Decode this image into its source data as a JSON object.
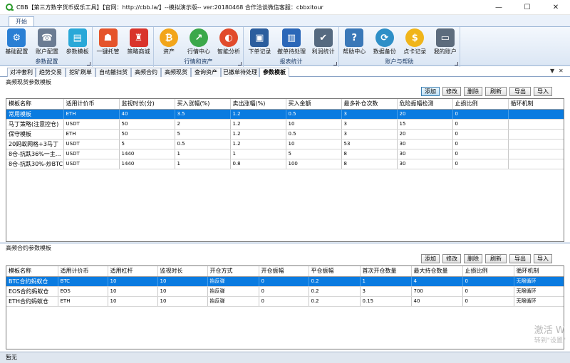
{
  "window": {
    "title": "CBB【第三方数字货币娱乐工具】【官网：http://cbb.la/】--模拟演示版-- ver:20180468    合作洽谈微信客服：cbbxitour",
    "min": "—",
    "max": "☐",
    "close": "✕"
  },
  "ribbon": {
    "tab": "开始",
    "groups": [
      {
        "label": "参数配置",
        "buttons": [
          {
            "label": "基础配置",
            "icon": "gear-box-icon",
            "color": "#2a7fd4",
            "glyph": "⚙"
          },
          {
            "label": "账户配置",
            "icon": "phone-icon",
            "color": "#6b7c93",
            "glyph": "☎"
          },
          {
            "label": "参数模板",
            "icon": "tablet-icon",
            "color": "#29a8d8",
            "glyph": "▤"
          }
        ]
      },
      {
        "label": "",
        "buttons": [
          {
            "label": "一键托管",
            "icon": "robot-icon",
            "color": "#e5542b",
            "glyph": "☗"
          },
          {
            "label": "策略商城",
            "icon": "store-icon",
            "color": "#d9342b",
            "glyph": "♜"
          }
        ]
      },
      {
        "label": "行情和资产",
        "buttons": [
          {
            "label": "资产",
            "icon": "bitcoin-icon",
            "color": "#f2a51a",
            "glyph": "₿"
          },
          {
            "label": "行情中心",
            "icon": "chart-up-icon",
            "color": "#3ba84a",
            "glyph": "↗"
          },
          {
            "label": "智能分析",
            "icon": "analysis-icon",
            "color": "#e14b2c",
            "glyph": "◐"
          }
        ]
      },
      {
        "label": "报表统计",
        "buttons": [
          {
            "label": "下单记录",
            "icon": "record-icon",
            "color": "#2c5e9e",
            "glyph": "▣"
          },
          {
            "label": "撤单待处理",
            "icon": "folder-icon",
            "color": "#2b67b8",
            "glyph": "▥"
          },
          {
            "label": "利润统计",
            "icon": "check-list-icon",
            "color": "#566a80",
            "glyph": "✔"
          }
        ]
      },
      {
        "label": "账户与帮助",
        "buttons": [
          {
            "label": "帮助中心",
            "icon": "help-user-icon",
            "color": "#3a78b8",
            "glyph": "?"
          },
          {
            "label": "数据备份",
            "icon": "backup-icon",
            "color": "#2e8fc7",
            "glyph": "⟳"
          },
          {
            "label": "点卡记录",
            "icon": "dollar-icon",
            "color": "#f0b51a",
            "glyph": "$"
          },
          {
            "label": "我的账户",
            "icon": "monitor-icon",
            "color": "#5d6c7d",
            "glyph": "▭"
          }
        ]
      }
    ]
  },
  "doctabs": [
    "对冲套利",
    "趋势交易",
    "挖矿刷单",
    "自动搬扫货",
    "高频合约",
    "高频现货",
    "查询资产",
    "已撤单待处理",
    "参数模板"
  ],
  "doctab_active": 8,
  "doctab_controls": [
    "▼",
    "✕"
  ],
  "buttons": {
    "add": "添加",
    "edit": "修改",
    "delete": "删除",
    "refresh": "刷新",
    "export": "导出",
    "import": "导入"
  },
  "spot": {
    "title": "高频现货参数模板",
    "headers": [
      "模板名称",
      "适用计价币",
      "监视时长(分)",
      "买入涨幅(%)",
      "卖出涨幅(%)",
      "买入金额",
      "最多补仓次数",
      "危险振幅检测",
      "止损比例",
      "循环机制"
    ],
    "rows": [
      [
        "常用模板",
        "ETH",
        "40",
        "3.5",
        "1.2",
        "0.5",
        "3",
        "20",
        "0",
        ""
      ],
      [
        "马丁策略(注意控仓)",
        "USDT",
        "50",
        "2",
        "1.2",
        "10",
        "3",
        "15",
        "0",
        ""
      ],
      [
        "保守模板",
        "ETH",
        "50",
        "5",
        "1.2",
        "0.5",
        "3",
        "20",
        "0",
        ""
      ],
      [
        "20蚂蚁网格+3马丁",
        "USDT",
        "5",
        "0.5",
        "1.2",
        "10",
        "53",
        "30",
        "0",
        ""
      ],
      [
        "8仓-抗跌36%一主...",
        "USDT",
        "1440",
        "1",
        "1",
        "5",
        "8",
        "30",
        "0",
        ""
      ],
      [
        "8仓-抗跌30%-炒BTC",
        "USDT",
        "1440",
        "1",
        "0.8",
        "100",
        "8",
        "30",
        "0",
        ""
      ]
    ]
  },
  "contract": {
    "title": "高频合约参数模板",
    "headers": [
      "模板名称",
      "适用计价币",
      "适用杠杆",
      "监视时长",
      "开仓方式",
      "开仓振幅",
      "平仓振幅",
      "首次开仓数量",
      "最大持仓数量",
      "止损比例",
      "循环机制"
    ],
    "rows": [
      [
        "BTC合约蚂蚁仓",
        "BTC",
        "10",
        "10",
        "抬反弹",
        "0",
        "0.2",
        "1",
        "4",
        "0",
        "无限循环"
      ],
      [
        "EOS合约蚂蚁仓",
        "EOS",
        "10",
        "10",
        "抬反弹",
        "0",
        "0.2",
        "3",
        "700",
        "0",
        "无限循环"
      ],
      [
        "ETH合约蚂蚁仓",
        "ETH",
        "10",
        "10",
        "抬反弹",
        "0",
        "0.2",
        "0.15",
        "40",
        "0",
        "无限循环"
      ]
    ]
  },
  "status": "暂无",
  "watermark": {
    "line1": "激活 W",
    "line2": "转到\"设置\""
  }
}
